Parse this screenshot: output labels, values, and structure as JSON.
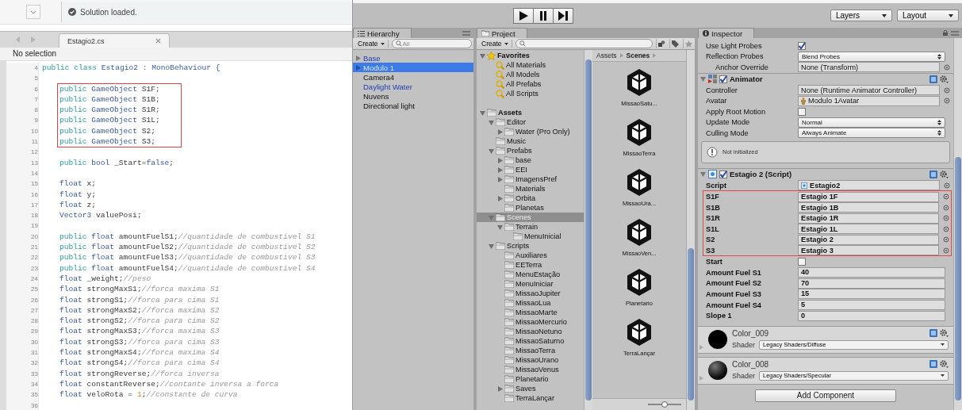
{
  "editor": {
    "status": "Solution loaded.",
    "tab": "Estagio2.cs",
    "breadcrumb": "No selection",
    "blocks": [
      {
        "indented": false,
        "highlighted": false,
        "lines": [
          {
            "number": "4",
            "tokens": [
              {
                "text": "public ",
                "kind": "keyword"
              },
              {
                "text": "class ",
                "kind": "keyword"
              },
              {
                "text": "Estagio2 ",
                "kind": "type"
              },
              {
                "text": ": ",
                "kind": "type"
              },
              {
                "text": "MonoBehaviour ",
                "kind": "type"
              },
              {
                "text": "{",
                "kind": "type"
              }
            ]
          },
          {
            "number": "5"
          }
        ]
      },
      {
        "indented": true,
        "highlighted": true,
        "lines": [
          {
            "number": "6",
            "tokens": [
              {
                "text": "public ",
                "kind": "keyword"
              },
              {
                "text": "GameObject ",
                "kind": "type"
              },
              {
                "text": "S1F;",
                "kind": "plain"
              }
            ]
          },
          {
            "number": "7",
            "tokens": [
              {
                "text": "public ",
                "kind": "keyword"
              },
              {
                "text": "GameObject ",
                "kind": "type"
              },
              {
                "text": "S1B;",
                "kind": "plain"
              }
            ]
          },
          {
            "number": "8",
            "tokens": [
              {
                "text": "public ",
                "kind": "keyword"
              },
              {
                "text": "GameObject ",
                "kind": "type"
              },
              {
                "text": "S1R;",
                "kind": "plain"
              }
            ]
          },
          {
            "number": "9",
            "tokens": [
              {
                "text": "public ",
                "kind": "keyword"
              },
              {
                "text": "GameObject ",
                "kind": "type"
              },
              {
                "text": "S1L;",
                "kind": "plain"
              }
            ]
          },
          {
            "number": "10",
            "tokens": [
              {
                "text": "public ",
                "kind": "keyword"
              },
              {
                "text": "GameObject ",
                "kind": "type"
              },
              {
                "text": "S2;",
                "kind": "plain"
              }
            ]
          },
          {
            "number": "11",
            "tokens": [
              {
                "text": "public ",
                "kind": "keyword"
              },
              {
                "text": "GameObject ",
                "kind": "type"
              },
              {
                "text": "S3;",
                "kind": "plain"
              }
            ]
          }
        ]
      },
      {
        "indented": true,
        "highlighted": false,
        "lines": [
          {
            "number": "12"
          },
          {
            "number": "13",
            "tokens": [
              {
                "text": "public ",
                "kind": "keyword"
              },
              {
                "text": "bool ",
                "kind": "type"
              },
              {
                "text": "_Start=",
                "kind": "plain"
              },
              {
                "text": "false",
                "kind": "type"
              },
              {
                "text": ";",
                "kind": "plain"
              }
            ]
          },
          {
            "number": "14"
          },
          {
            "number": "15",
            "tokens": [
              {
                "text": "float ",
                "kind": "type"
              },
              {
                "text": "x;",
                "kind": "plain"
              }
            ]
          },
          {
            "number": "16",
            "tokens": [
              {
                "text": "float ",
                "kind": "type"
              },
              {
                "text": "y;",
                "kind": "plain"
              }
            ]
          },
          {
            "number": "17",
            "tokens": [
              {
                "text": "float ",
                "kind": "type"
              },
              {
                "text": "z;",
                "kind": "plain"
              }
            ]
          },
          {
            "number": "18",
            "tokens": [
              {
                "text": "Vector3 ",
                "kind": "type"
              },
              {
                "text": "valuePosi;",
                "kind": "plain"
              }
            ]
          },
          {
            "number": "19"
          },
          {
            "number": "20",
            "tokens": [
              {
                "text": "public ",
                "kind": "keyword"
              },
              {
                "text": "float ",
                "kind": "type"
              },
              {
                "text": "amountFuelS1;",
                "kind": "plain"
              },
              {
                "text": "//quantidade de combustivel S1",
                "kind": "comment"
              }
            ]
          },
          {
            "number": "21",
            "tokens": [
              {
                "text": "public ",
                "kind": "keyword"
              },
              {
                "text": "float ",
                "kind": "type"
              },
              {
                "text": "amountFuelS2;",
                "kind": "plain"
              },
              {
                "text": "//quantidade de combustivel S2",
                "kind": "comment"
              }
            ]
          },
          {
            "number": "22",
            "tokens": [
              {
                "text": "public ",
                "kind": "keyword"
              },
              {
                "text": "float ",
                "kind": "type"
              },
              {
                "text": "amountFuelS3;",
                "kind": "plain"
              },
              {
                "text": "//quantidade de combustivel S3",
                "kind": "comment"
              }
            ]
          },
          {
            "number": "23",
            "tokens": [
              {
                "text": "public ",
                "kind": "keyword"
              },
              {
                "text": "float ",
                "kind": "type"
              },
              {
                "text": "amountFuelS4;",
                "kind": "plain"
              },
              {
                "text": "//quantidade de combustivel S4",
                "kind": "comment"
              }
            ]
          },
          {
            "number": "24",
            "tokens": [
              {
                "text": "float ",
                "kind": "type"
              },
              {
                "text": "_weight;",
                "kind": "plain"
              },
              {
                "text": "//peso",
                "kind": "comment"
              }
            ]
          },
          {
            "number": "25",
            "tokens": [
              {
                "text": "float ",
                "kind": "type"
              },
              {
                "text": "strongMaxS1;",
                "kind": "plain"
              },
              {
                "text": "//forca maxima S1",
                "kind": "comment"
              }
            ]
          },
          {
            "number": "26",
            "tokens": [
              {
                "text": "float ",
                "kind": "type"
              },
              {
                "text": "strongS1;",
                "kind": "plain"
              },
              {
                "text": "//forca para cima S1",
                "kind": "comment"
              }
            ]
          },
          {
            "number": "27",
            "tokens": [
              {
                "text": "float ",
                "kind": "type"
              },
              {
                "text": "strongMaxS2;",
                "kind": "plain"
              },
              {
                "text": "//forca maxima S2",
                "kind": "comment"
              }
            ]
          },
          {
            "number": "28",
            "tokens": [
              {
                "text": "float ",
                "kind": "type"
              },
              {
                "text": "strongS2;",
                "kind": "plain"
              },
              {
                "text": "//forca para cima S2",
                "kind": "comment"
              }
            ]
          },
          {
            "number": "29",
            "tokens": [
              {
                "text": "float ",
                "kind": "type"
              },
              {
                "text": "strongMaxS3;",
                "kind": "plain"
              },
              {
                "text": "//forca maxima S3",
                "kind": "comment"
              }
            ]
          },
          {
            "number": "30",
            "tokens": [
              {
                "text": "float ",
                "kind": "type"
              },
              {
                "text": "strongS3;",
                "kind": "plain"
              },
              {
                "text": "//forca para cima S3",
                "kind": "comment"
              }
            ]
          },
          {
            "number": "31",
            "tokens": [
              {
                "text": "float ",
                "kind": "type"
              },
              {
                "text": "strongMaxS4;",
                "kind": "plain"
              },
              {
                "text": "//forca maxima S4",
                "kind": "comment"
              }
            ]
          },
          {
            "number": "32",
            "tokens": [
              {
                "text": "float ",
                "kind": "type"
              },
              {
                "text": "strongS4;",
                "kind": "plain"
              },
              {
                "text": "//forca para cima S4",
                "kind": "comment"
              }
            ]
          },
          {
            "number": "33",
            "tokens": [
              {
                "text": "float ",
                "kind": "type"
              },
              {
                "text": "strongReverse;",
                "kind": "plain"
              },
              {
                "text": "//forca inversa",
                "kind": "comment"
              }
            ]
          },
          {
            "number": "34",
            "tokens": [
              {
                "text": "float ",
                "kind": "type"
              },
              {
                "text": "constantReverse;",
                "kind": "plain"
              },
              {
                "text": "//contante inversa a forca",
                "kind": "comment"
              }
            ]
          },
          {
            "number": "35",
            "tokens": [
              {
                "text": "float ",
                "kind": "type"
              },
              {
                "text": "veloRota = ",
                "kind": "plain"
              },
              {
                "text": "1",
                "kind": "number"
              },
              {
                "text": ";",
                "kind": "plain"
              },
              {
                "text": "//constante de curva",
                "kind": "comment"
              }
            ]
          },
          {
            "number": "36"
          }
        ]
      }
    ]
  },
  "toolbar": {
    "play_controls": [
      {
        "kind": "play"
      },
      {
        "kind": "pause"
      },
      {
        "kind": "step"
      }
    ],
    "layers": "Layers",
    "layout": "Layout"
  },
  "hierarchy": {
    "tab": "Hierarchy",
    "create": "Create",
    "search_placeholder": "All",
    "items": [
      {
        "label": "Base",
        "expanded": false,
        "selected": false,
        "prefab": true
      },
      {
        "label": "Modulo 1",
        "expanded": false,
        "selected": true,
        "prefab": true
      },
      {
        "label": "Camera4",
        "selected": false,
        "prefab": false
      },
      {
        "label": "Daylight Water",
        "selected": false,
        "prefab": true
      },
      {
        "label": "Nuvens",
        "selected": false,
        "prefab": false
      },
      {
        "label": "Directional light",
        "selected": false,
        "prefab": false
      }
    ]
  },
  "project": {
    "tab": "Project",
    "create": "Create",
    "breadcrumb": [
      "Assets",
      "Scenes"
    ],
    "tree": [
      {
        "label": "Favorites",
        "kind": "favorites",
        "expanded": true,
        "selected": false,
        "children": [
          {
            "label": "All Materials",
            "kind": "search",
            "selected": false
          },
          {
            "label": "All Models",
            "kind": "search",
            "selected": false
          },
          {
            "label": "All Prefabs",
            "kind": "search",
            "selected": false
          },
          {
            "label": "All Scripts",
            "kind": "search",
            "selected": false
          }
        ]
      },
      {
        "label": "Assets",
        "kind": "folder",
        "expanded": true,
        "selected": false,
        "children": [
          {
            "label": "Editor",
            "kind": "folder",
            "expanded": true,
            "selected": false,
            "children": [
              {
                "label": "Water (Pro Only)",
                "kind": "folder",
                "expanded": false,
                "selected": false
              }
            ]
          },
          {
            "label": "Music",
            "kind": "folder",
            "selected": false
          },
          {
            "label": "Prefabs",
            "kind": "folder",
            "expanded": true,
            "selected": false,
            "children": [
              {
                "label": "base",
                "kind": "folder",
                "expanded": false,
                "selected": false
              },
              {
                "label": "EEI",
                "kind": "folder",
                "expanded": false,
                "selected": false
              },
              {
                "label": "ImagensPref",
                "kind": "folder",
                "expanded": false,
                "selected": false
              },
              {
                "label": "Materials",
                "kind": "folder",
                "selected": false
              },
              {
                "label": "Orbita",
                "kind": "folder",
                "expanded": false,
                "selected": false
              },
              {
                "label": "Planetas",
                "kind": "folder",
                "selected": false
              }
            ]
          },
          {
            "label": "Scenes",
            "kind": "folder",
            "expanded": true,
            "selected": true,
            "children": [
              {
                "label": "Terrain",
                "kind": "folder",
                "expanded": true,
                "selected": false,
                "children": [
                  {
                    "label": "MenuInicial",
                    "kind": "folder",
                    "selected": false
                  }
                ]
              }
            ]
          },
          {
            "label": "Scripts",
            "kind": "folder",
            "expanded": true,
            "selected": false,
            "children": [
              {
                "label": "Auxiliares",
                "kind": "folder",
                "selected": false
              },
              {
                "label": "EETerra",
                "kind": "folder",
                "selected": false
              },
              {
                "label": "MenuEstação",
                "kind": "folder",
                "selected": false
              },
              {
                "label": "MenuIniciar",
                "kind": "folder",
                "selected": false
              },
              {
                "label": "MissaoJupiter",
                "kind": "folder",
                "selected": false
              },
              {
                "label": "MissaoLua",
                "kind": "folder",
                "selected": false
              },
              {
                "label": "MissaoMarte",
                "kind": "folder",
                "selected": false
              },
              {
                "label": "MissaoMercurio",
                "kind": "folder",
                "selected": false
              },
              {
                "label": "MissaoNetuno",
                "kind": "folder",
                "selected": false
              },
              {
                "label": "MissaoSaturno",
                "kind": "folder",
                "selected": false
              },
              {
                "label": "MissaoTerra",
                "kind": "folder",
                "selected": false
              },
              {
                "label": "MissaoUrano",
                "kind": "folder",
                "selected": false
              },
              {
                "label": "MissaoVenus",
                "kind": "folder",
                "selected": false
              },
              {
                "label": "Planetario",
                "kind": "folder",
                "selected": false
              },
              {
                "label": "Saves",
                "kind": "folder",
                "expanded": false,
                "selected": false
              },
              {
                "label": "TerraLançar",
                "kind": "folder",
                "selected": false
              }
            ]
          }
        ]
      }
    ],
    "assets": [
      {
        "name": "MissaoSatu..."
      },
      {
        "name": "MissaoTerra"
      },
      {
        "name": "MissaoUra..."
      },
      {
        "name": "MissaoVen..."
      },
      {
        "name": "Planetario"
      },
      {
        "name": "TerraLançar"
      }
    ],
    "zoom_slider": {
      "level": 0.5
    }
  },
  "inspector": {
    "tab": "Inspector",
    "top_fields": [
      {
        "label": "Use Light Probes",
        "kind": "checkbox",
        "checked": true,
        "indented": false
      },
      {
        "label": "Reflection Probes",
        "kind": "dropdown",
        "value": "Blend Probes",
        "indented": false
      },
      {
        "label": "Anchor Override",
        "kind": "object",
        "value": "None (Transform)",
        "indented": true
      }
    ],
    "components": [
      {
        "title": "Animator",
        "kind": "animator",
        "enabled": true,
        "overridden": false,
        "groups": [
          {
            "highlighted": false,
            "fields": [
              {
                "label": "Controller",
                "kind": "object",
                "value": "None (Runtime Animator Controller)"
              },
              {
                "label": "Avatar",
                "kind": "avatar",
                "value": "Modulo 1Avatar"
              },
              {
                "label": "Apply Root Motion",
                "kind": "checkbox",
                "checked": false
              },
              {
                "label": "Update Mode",
                "kind": "dropdown",
                "value": "Normal"
              },
              {
                "label": "Culling Mode",
                "kind": "dropdown",
                "value": "Always Animate"
              }
            ]
          }
        ],
        "notice": "Not initialized"
      },
      {
        "title": "Estagio 2 (Script)",
        "kind": "script",
        "enabled": true,
        "overridden": true,
        "groups": [
          {
            "highlighted": false,
            "fields": [
              {
                "label": "Script",
                "kind": "script",
                "value": "Estagio2"
              }
            ]
          },
          {
            "highlighted": true,
            "fields": [
              {
                "label": "S1F",
                "kind": "object",
                "value": "Estagio 1F"
              },
              {
                "label": "S1B",
                "kind": "object",
                "value": "Estagio 1B"
              },
              {
                "label": "S1R",
                "kind": "object",
                "value": "Estagio 1R"
              },
              {
                "label": "S1L",
                "kind": "object",
                "value": "Estagio 1L"
              },
              {
                "label": "S2",
                "kind": "object",
                "value": "Estagio 2"
              },
              {
                "label": "S3",
                "kind": "object",
                "value": "Estagio 3"
              }
            ]
          },
          {
            "highlighted": false,
            "fields": [
              {
                "label": "Start",
                "kind": "checkbox",
                "checked": false
              },
              {
                "label": "Amount Fuel S1",
                "kind": "number",
                "value": "40"
              },
              {
                "label": "Amount Fuel S2",
                "kind": "number",
                "value": "70"
              },
              {
                "label": "Amount Fuel S3",
                "kind": "number",
                "value": "15"
              },
              {
                "label": "Amount Fuel S4",
                "kind": "number",
                "value": "5"
              },
              {
                "label": "Slope 1",
                "kind": "number",
                "value": "0"
              }
            ]
          }
        ]
      }
    ],
    "materials": [
      {
        "name": "Color_009",
        "shader_label": "Shader",
        "shader": "Legacy Shaders/Diffuse",
        "kind": "matte"
      },
      {
        "name": "Color_008",
        "shader_label": "Shader",
        "shader": "Legacy Shaders/Specular",
        "kind": "glossy"
      }
    ],
    "add_button": "Add Component"
  }
}
